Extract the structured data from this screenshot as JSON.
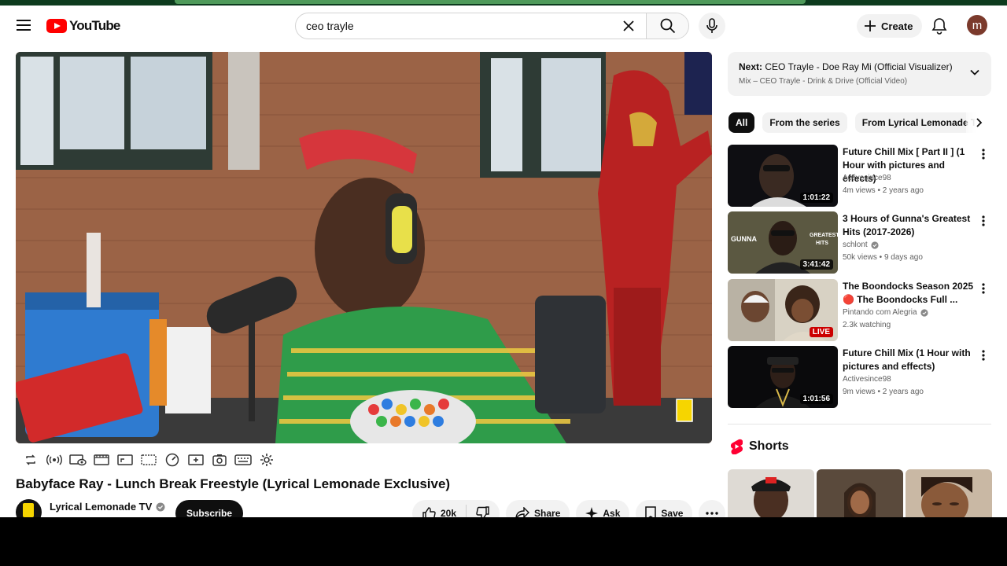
{
  "header": {
    "logo_text": "YouTube",
    "search_value": "ceo trayle",
    "create_label": "Create",
    "avatar_letter": "m"
  },
  "player": {
    "title": "Babyface Ray - Lunch Break Freestyle (Lyrical Lemonade Exclusive)",
    "channel_name": "Lyrical Lemonade TV",
    "subscribe_label": "Subscribe",
    "like_count": "20k",
    "share_label": "Share",
    "ask_label": "Ask",
    "save_label": "Save",
    "control_icons": [
      "loop-icon",
      "broadcast-icon",
      "ambient-icon",
      "theater-icon",
      "miniplayer-icon",
      "subtitles-box-icon",
      "speed-icon",
      "add-clip-icon",
      "screenshot-icon",
      "keyboard-icon",
      "settings-icon"
    ]
  },
  "next_up": {
    "label": "Next:",
    "title": "CEO Trayle - Doe Ray Mi (Official Visualizer)",
    "sub": "Mix – CEO Trayle - Drink & Drive (Official Video)"
  },
  "chips": [
    "All",
    "From the series",
    "From Lyrical Lemonade T"
  ],
  "recommendations": [
    {
      "title": "Future Chill Mix [ Part II ] (1 Hour with pictures and effects)",
      "channel": "Activesince98",
      "verified": false,
      "stats": "4m views • 2 years ago",
      "duration": "1:01:22",
      "live": false
    },
    {
      "title": "3 Hours of Gunna's Greatest Hits (2017-2026)",
      "channel": "schlont",
      "verified": true,
      "stats": "50k views • 9 days ago",
      "duration": "3:41:42",
      "live": false
    },
    {
      "title": "The Boondocks Season 2025 🔴 The Boondocks Full ...",
      "channel": "Pintando com Alegria",
      "verified": true,
      "stats": "2.3k watching",
      "duration": "LIVE",
      "live": true
    },
    {
      "title": "Future Chill Mix (1 Hour with pictures and effects)",
      "channel": "Activesince98",
      "verified": false,
      "stats": "9m views • 2 years ago",
      "duration": "1:01:56",
      "live": false
    }
  ],
  "shorts": {
    "label": "Shorts"
  },
  "colors": {
    "brand_red": "#ff0000",
    "chip_active": "#0f0f0f",
    "chip_bg": "#f2f2f2",
    "live_red": "#cc0000"
  }
}
